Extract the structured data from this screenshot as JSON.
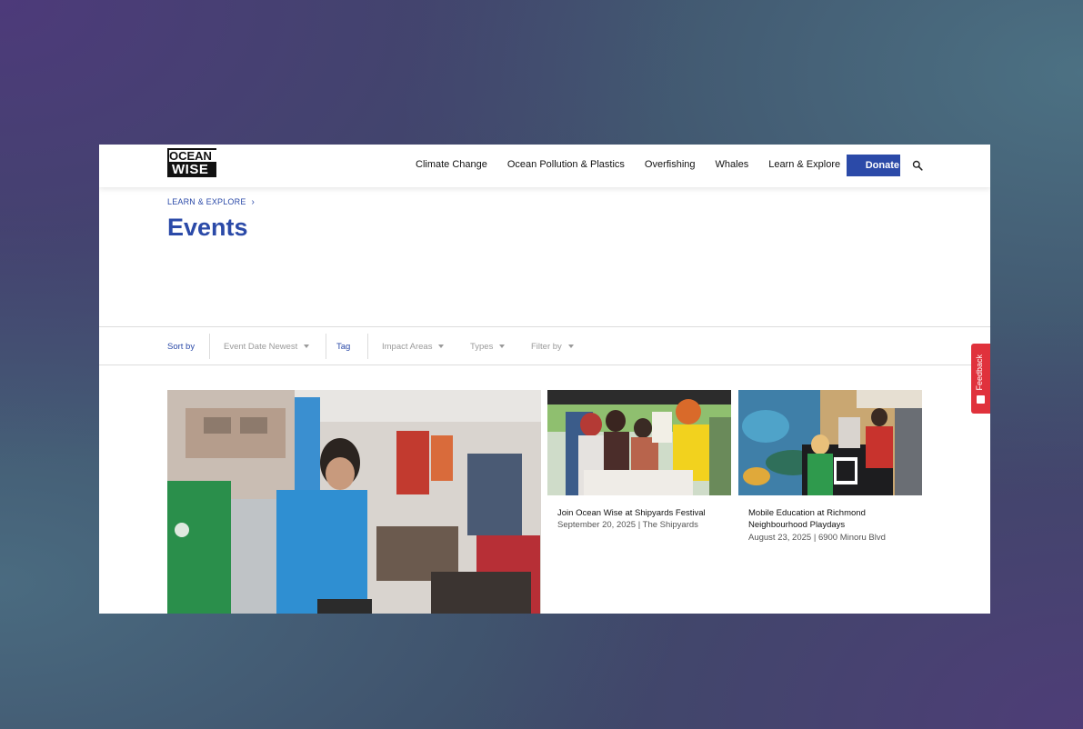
{
  "header": {
    "logo_line1": "OCEAN",
    "logo_line2": "WISE",
    "nav": [
      "Climate Change",
      "Ocean Pollution & Plastics",
      "Overfishing",
      "Whales",
      "Learn & Explore"
    ],
    "donate_label": "Donate",
    "search_icon": "search-icon"
  },
  "hero": {
    "breadcrumb": "LEARN & EXPLORE",
    "title": "Events"
  },
  "filters": {
    "sort_by_label": "Sort by",
    "sort_value": "Event Date Newest",
    "tag_label": "Tag",
    "impact_areas": "Impact Areas",
    "types": "Types",
    "filter_by": "Filter by"
  },
  "events": [
    {
      "title": "Join Ocean Wise at Shipyards Festival",
      "meta": "September 20, 2025 | The Shipyards"
    },
    {
      "title": "Mobile Education at Richmond Neighbourhood Playdays",
      "meta": "August 23, 2025 | 6900 Minoru Blvd"
    }
  ],
  "feedback_label": "Feedback",
  "colors": {
    "brand_blue": "#2b4aa8",
    "feedback_red": "#e0323c"
  }
}
